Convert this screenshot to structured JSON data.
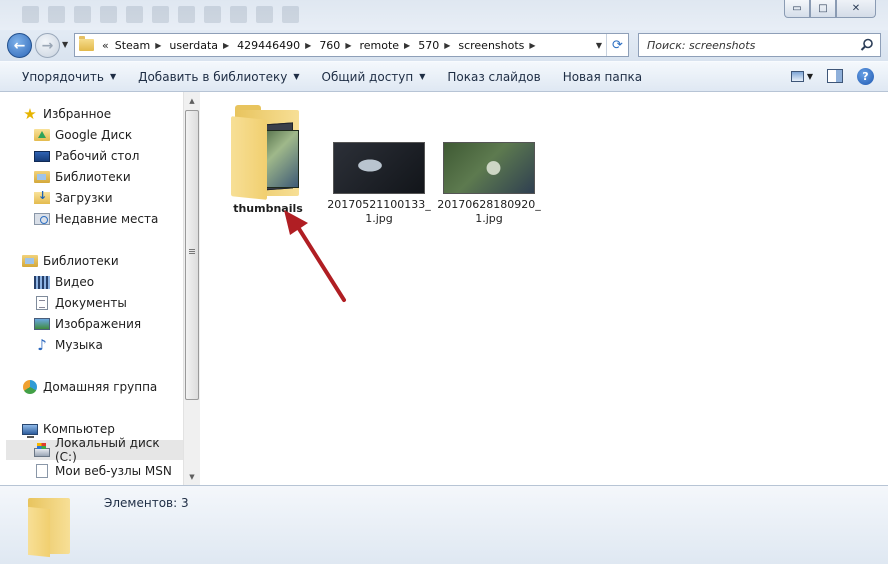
{
  "window": {
    "minimize_glyph": "▭",
    "maximize_glyph": "□",
    "close_glyph": "✕"
  },
  "nav": {
    "back_glyph": "←",
    "forward_glyph": "→",
    "breadcrumb_prefix": "«",
    "breadcrumbs": [
      "Steam",
      "userdata",
      "429446490",
      "760",
      "remote",
      "570",
      "screenshots"
    ],
    "search_placeholder": "Поиск: screenshots"
  },
  "toolbar": {
    "organize": "Упорядочить",
    "add_to_library": "Добавить в библиотеку",
    "share": "Общий доступ",
    "slideshow": "Показ слайдов",
    "new_folder": "Новая папка",
    "help": "?"
  },
  "sidebar": {
    "favorites": {
      "header": "Избранное",
      "items": [
        "Google Диск",
        "Рабочий стол",
        "Библиотеки",
        "Загрузки",
        "Недавние места"
      ]
    },
    "libraries": {
      "header": "Библиотеки",
      "items": [
        "Видео",
        "Документы",
        "Изображения",
        "Музыка"
      ]
    },
    "homegroup": "Домашняя группа",
    "computer": {
      "header": "Компьютер",
      "items": [
        "Локальный диск (C:)",
        "Мои веб-узлы MSN"
      ]
    }
  },
  "files": [
    {
      "name": "thumbnails",
      "type": "folder"
    },
    {
      "name": "20170521100133_1.jpg",
      "type": "image"
    },
    {
      "name": "20170628180920_1.jpg",
      "type": "image"
    }
  ],
  "file_labels": {
    "f0": "thumbnails",
    "f1_line1": "20170521100133_",
    "f1_line2": "1.jpg",
    "f2_line1": "20170628180920_",
    "f2_line2": "1.jpg"
  },
  "details": {
    "item_count": "Элементов: 3"
  },
  "colors": {
    "annotation_arrow": "#b01e23",
    "selection": "#e6e6e6"
  }
}
